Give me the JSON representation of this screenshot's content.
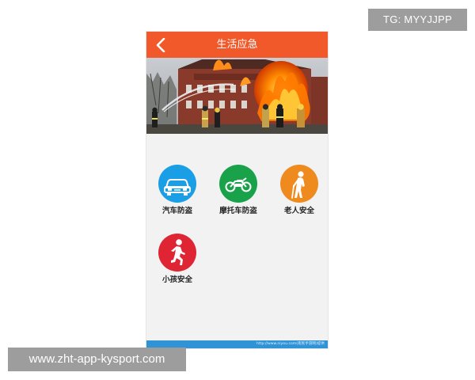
{
  "watermarks": {
    "top_right": "TG: MYYJJPP",
    "bottom_left": "www.zht-app-kysport.com"
  },
  "header": {
    "title": "生活应急",
    "back_icon": "chevron-left-icon"
  },
  "banner": {
    "subject": "firefighters-burning-building-photo"
  },
  "menu": {
    "items": [
      {
        "label": "汽车防盗",
        "icon": "car-icon",
        "color": "#1a9ee5"
      },
      {
        "label": "摩托车防盗",
        "icon": "motorcycle-icon",
        "color": "#1aa24a"
      },
      {
        "label": "老人安全",
        "icon": "elderly-person-icon",
        "color": "#ee8a1e"
      },
      {
        "label": "小孩安全",
        "icon": "running-child-icon",
        "color": "#df2534"
      }
    ]
  },
  "footer": {
    "url_text": "http://www.niyou.com(南民手游网)提供"
  },
  "colors": {
    "header": "#f2592a",
    "footer": "#2f93d6",
    "background": "#f2f2f2"
  }
}
